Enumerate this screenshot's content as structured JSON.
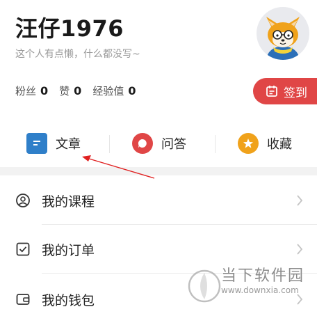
{
  "profile": {
    "username": "汪仔1976",
    "bio": "这个人有点懒，什么都没写~"
  },
  "stats": [
    {
      "label": "粉丝",
      "value": "0"
    },
    {
      "label": "赞",
      "value": "0"
    },
    {
      "label": "经验值",
      "value": "0"
    }
  ],
  "signin": {
    "label": "签到"
  },
  "actions": [
    {
      "label": "文章",
      "icon": "article-icon",
      "color": "#2f7fc9"
    },
    {
      "label": "问答",
      "icon": "qa-icon",
      "color": "#e04646"
    },
    {
      "label": "收藏",
      "icon": "star-icon",
      "color": "#f0a21b"
    }
  ],
  "menu": [
    {
      "label": "我的课程",
      "icon": "user-circle-icon"
    },
    {
      "label": "我的订单",
      "icon": "checkbox-icon"
    },
    {
      "label": "我的钱包",
      "icon": "wallet-icon"
    }
  ],
  "watermark": {
    "text": "当下软件园",
    "url": "www.downxia.com"
  }
}
